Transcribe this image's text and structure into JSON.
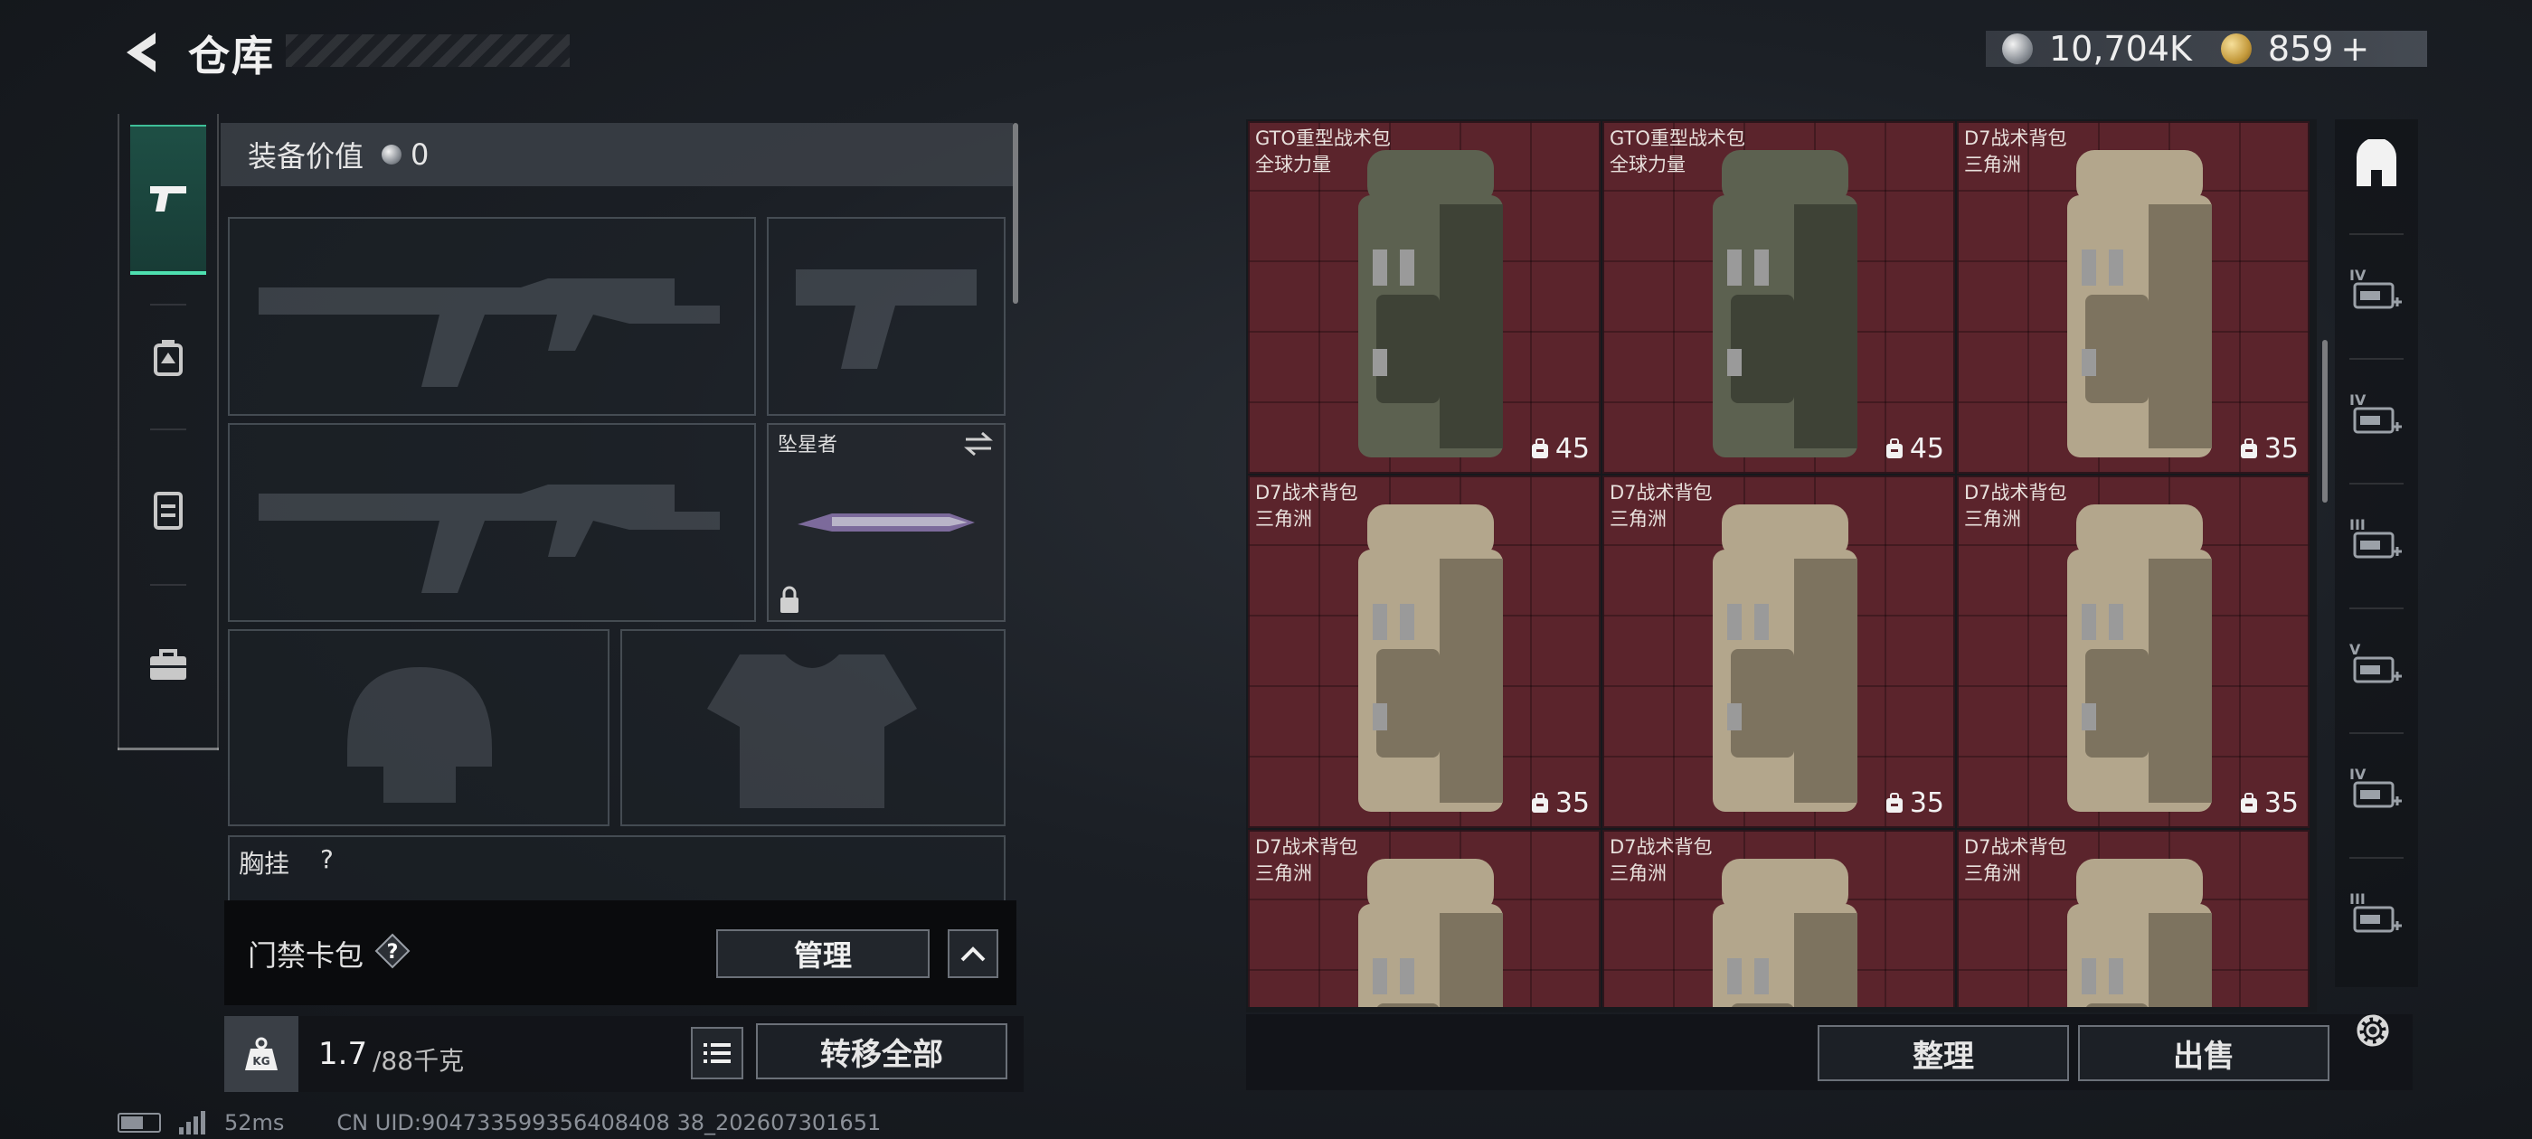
{
  "header": {
    "title": "仓库"
  },
  "currency": {
    "silver": "10,704K",
    "gold": "859",
    "gold_add": "+"
  },
  "tabs": [
    {
      "id": "firearms",
      "icon": "pistol-icon",
      "active": true
    },
    {
      "id": "medical",
      "icon": "medkit-icon",
      "active": false
    },
    {
      "id": "backpack",
      "icon": "backpack-icon",
      "active": false
    },
    {
      "id": "tools",
      "icon": "briefcase-icon",
      "active": false
    }
  ],
  "loadout": {
    "equip_value_label": "装备价值",
    "equip_value": "0",
    "melee_name": "坠星者",
    "chest_label": "胸挂",
    "chest_value": "?"
  },
  "keycard": {
    "label": "门禁卡包",
    "help": "?",
    "manage_label": "管理"
  },
  "weight": {
    "current": "1.7",
    "max": "/88千克",
    "transfer_all_label": "转移全部"
  },
  "status": {
    "ping": "52ms",
    "uid": "CN UID:904733599356408408 38_202607301651"
  },
  "stash": {
    "items": [
      {
        "name": "GTO重型战术包",
        "sub": "全球力量",
        "capacity": "45",
        "tone": "green"
      },
      {
        "name": "GTO重型战术包",
        "sub": "全球力量",
        "capacity": "45",
        "tone": "green"
      },
      {
        "name": "D7战术背包",
        "sub": "三角洲",
        "capacity": "35",
        "tone": "tan"
      },
      {
        "name": "D7战术背包",
        "sub": "三角洲",
        "capacity": "35",
        "tone": "tan"
      },
      {
        "name": "D7战术背包",
        "sub": "三角洲",
        "capacity": "35",
        "tone": "tan"
      },
      {
        "name": "D7战术背包",
        "sub": "三角洲",
        "capacity": "35",
        "tone": "tan"
      },
      {
        "name": "D7战术背包",
        "sub": "三角洲",
        "capacity": "",
        "tone": "tan"
      },
      {
        "name": "D7战术背包",
        "sub": "三角洲",
        "capacity": "",
        "tone": "tan"
      },
      {
        "name": "D7战术背包",
        "sub": "三角洲",
        "capacity": "",
        "tone": "tan"
      }
    ],
    "sort_label": "整理",
    "sell_label": "出售"
  },
  "filters": [
    {
      "name": "filter-all-icon",
      "tier": ""
    },
    {
      "name": "filter-medical-iv-icon",
      "tier": "IV"
    },
    {
      "name": "filter-ammo-iv-icon",
      "tier": "IV"
    },
    {
      "name": "filter-gun-iii-icon",
      "tier": "III"
    },
    {
      "name": "filter-device-v-icon",
      "tier": "V"
    },
    {
      "name": "filter-gun-iv-icon",
      "tier": "IV"
    },
    {
      "name": "filter-gun-iii-b-icon",
      "tier": "III"
    }
  ],
  "colors": {
    "accent": "#4ee0b0",
    "stash_cell": "#5b242c",
    "panel": "#1c2026"
  }
}
